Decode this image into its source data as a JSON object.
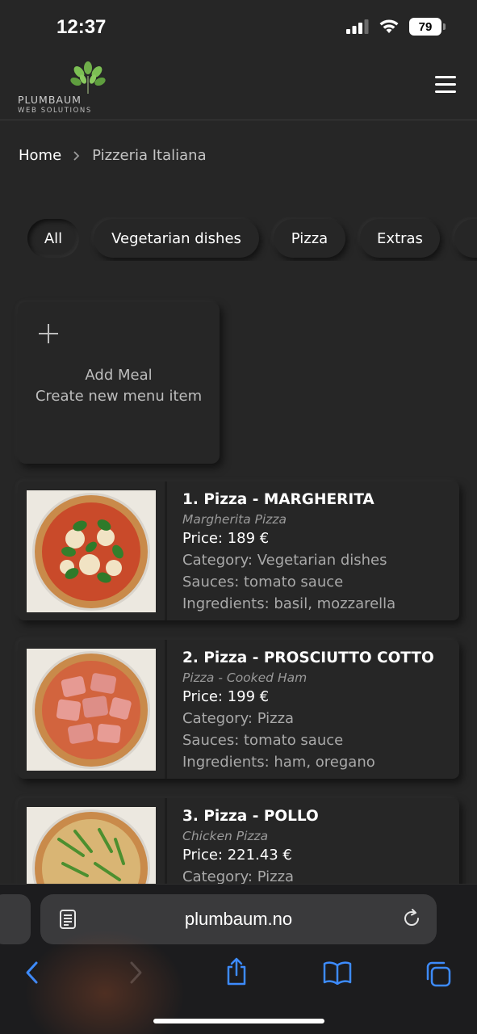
{
  "status_bar": {
    "time": "12:37",
    "battery": "79"
  },
  "header": {
    "logo_name": "PLUMBAUM",
    "logo_sub": "WEB SOLUTIONS"
  },
  "breadcrumb": {
    "home": "Home",
    "separator": ">",
    "current": "Pizzeria Italiana"
  },
  "filters": [
    {
      "label": "All",
      "active": true
    },
    {
      "label": "Vegetarian dishes",
      "active": false
    },
    {
      "label": "Pizza",
      "active": false
    },
    {
      "label": "Extras",
      "active": false
    }
  ],
  "add_meal": {
    "title": "Add Meal",
    "subtitle": "Create new menu item"
  },
  "menu_items": [
    {
      "title": "1. Pizza - MARGHERITA",
      "subtitle": "Margherita Pizza",
      "price": "Price: 189 €",
      "category": "Category: Vegetarian dishes",
      "sauces": "Sauces: tomato sauce",
      "ingredients": "Ingredients: basil, mozzarella"
    },
    {
      "title": "2. Pizza - PROSCIUTTO COTTO",
      "subtitle": "Pizza - Cooked Ham",
      "price": "Price: 199 €",
      "category": "Category: Pizza",
      "sauces": "Sauces: tomato sauce",
      "ingredients": "Ingredients: ham, oregano"
    },
    {
      "title": "3. Pizza - POLLO",
      "subtitle": "Chicken Pizza",
      "price": "Price: 221.43 €",
      "category": "Category: Pizza"
    }
  ],
  "browser": {
    "url": "plumbaum.no"
  },
  "colors": {
    "background": "#262626",
    "browser_accent": "#3d8bfd"
  }
}
